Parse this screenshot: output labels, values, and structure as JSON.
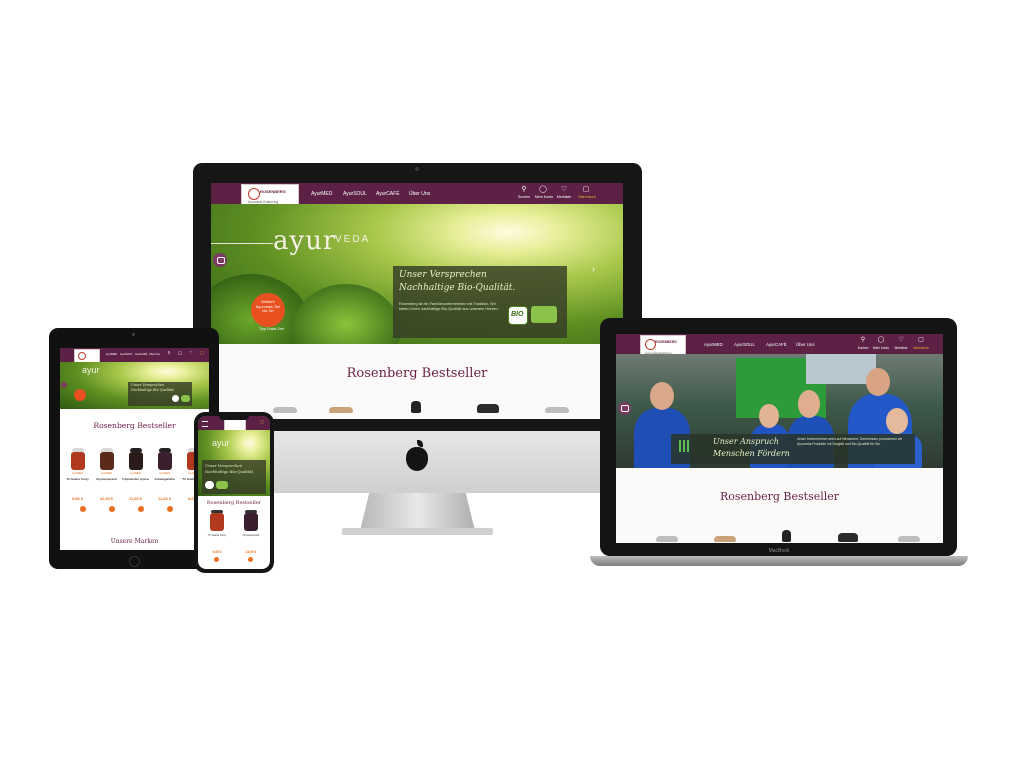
{
  "colors": {
    "brand": "#5c2145",
    "accent": "#e8701f",
    "title": "#6b2148"
  },
  "site": {
    "logo_brand": "ROSENBERG",
    "logo_line1": "Ayurveda Erfahrung",
    "logo_line2": "seit Bio-Qualität",
    "nav": [
      "AyurMED",
      "AyurSOUL",
      "AyurCAFÉ",
      "Über Uns"
    ],
    "icons": [
      "Suchen",
      "Mein Konto",
      "Merkliste",
      "Warenkorb"
    ],
    "cart_count": "0",
    "bestseller_title": "Rosenberg Bestseller",
    "brands_title": "Unsere Marken"
  },
  "monitor": {
    "hero_brand_main": "ayur",
    "hero_brand_sub": "VEDA",
    "promise_line1": "Unser Versprechen",
    "promise_line2": "Nachhaltige Bio-Qualität.",
    "promise_body": "Rosenberg ist ein Familienunternehmen mit Tradition. Wir bieten Ihnen nachhaltige Bio-Qualität aus unserem Herzen.",
    "badge_line1": "Weitere",
    "badge_line2": "Ayurveda-Tee",
    "badge_line3": "bis 3x!",
    "badge_line4": "Tipp",
    "badge_line5": "Gratis-Tee!",
    "bio_label": "BIO"
  },
  "laptop": {
    "claim_line1": "Unser Anspruch",
    "claim_line2": "Menschen Fördern",
    "claim_body": "Unser Unternehmen setzt auf Menschen. Gemeinsam produzieren wir Ayurveda-Produkte mit Sorgfalt und Bio-Qualität für Sie.",
    "brand_label": "MacBook"
  },
  "tablet": {
    "products": [
      {
        "brand": "AyurMED",
        "name": "Tri Gasha Curry",
        "price": "9,80 €"
      },
      {
        "brand": "AyurMED",
        "name": "Chyavanprash",
        "price": "22,90 €"
      },
      {
        "brand": "AyurMED",
        "name": "Triphala Bio Ayurveda",
        "price": "11,60 €"
      },
      {
        "brand": "AyurMED",
        "name": "Ashwagandha",
        "price": "11,60 €"
      },
      {
        "brand": "AyurMED",
        "name": "Tri Gasha Curry",
        "price": "9,60 €"
      }
    ]
  },
  "phone": {
    "products": [
      {
        "name": "Tri Gasha Curry",
        "price": "9,80 €"
      },
      {
        "name": "Chyavanprash",
        "price": "22,90 €"
      }
    ]
  }
}
